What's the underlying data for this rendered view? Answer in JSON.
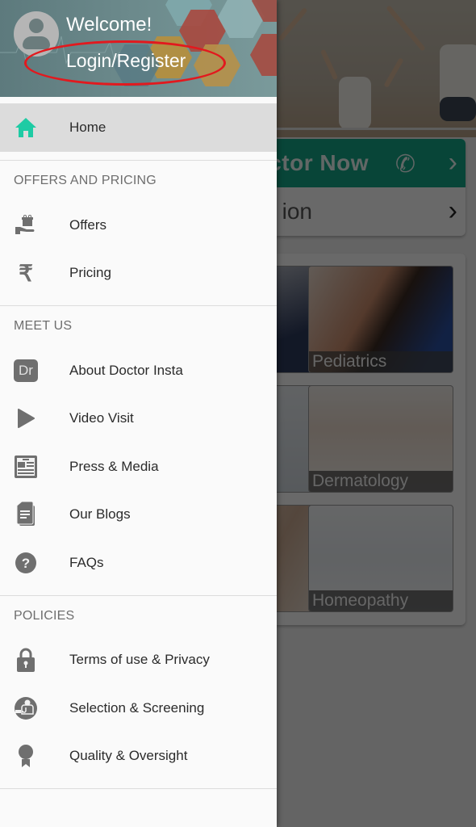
{
  "drawer": {
    "header": {
      "welcome": "Welcome!",
      "login_register": "Login/Register",
      "avatar_icon": "account-circle-icon"
    },
    "home": {
      "label": "Home",
      "icon": "home-icon",
      "active": true,
      "accent_color": "#1ecba4"
    },
    "sections": [
      {
        "title": "OFFERS AND PRICING",
        "items": [
          {
            "label": "Offers",
            "icon": "gift-hand-icon"
          },
          {
            "label": "Pricing",
            "icon": "rupee-icon"
          }
        ]
      },
      {
        "title": "MEET US",
        "items": [
          {
            "label": "About Doctor Insta",
            "icon": "dr-badge-icon",
            "icon_text": "Dr"
          },
          {
            "label": "Video Visit",
            "icon": "play-icon"
          },
          {
            "label": "Press & Media",
            "icon": "newspaper-icon"
          },
          {
            "label": "Our Blogs",
            "icon": "documents-icon"
          },
          {
            "label": "FAQs",
            "icon": "help-circle-icon"
          }
        ]
      },
      {
        "title": "POLICIES",
        "items": [
          {
            "label": "Terms of use & Privacy",
            "icon": "lock-icon"
          },
          {
            "label": "Selection & Screening",
            "icon": "doctor-screening-icon"
          },
          {
            "label": "Quality & Oversight",
            "icon": "award-ribbon-icon"
          }
        ]
      }
    ]
  },
  "background": {
    "call_button_text": "Talk to a Doctor Now",
    "call_visible_text": "ctor Now",
    "consult_visible_text": "ion",
    "tiles": [
      {
        "label": "Pediatrics"
      },
      {
        "label": "Dermatology"
      },
      {
        "label": "Homeopathy"
      }
    ],
    "call_color": "#14a586"
  }
}
